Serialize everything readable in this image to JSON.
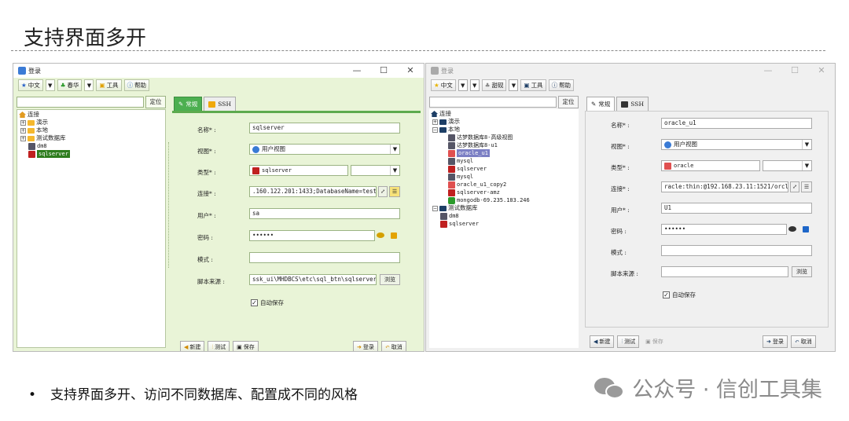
{
  "slide": {
    "title": "支持界面多开",
    "bullet": "支持界面多开、访问不同数据库、配置成不同的风格",
    "brand": "公众号 · 信创工具集"
  },
  "window1": {
    "title": "登录",
    "controls": [
      "—",
      "☐",
      "✕"
    ],
    "toolbar": {
      "lang": "中文",
      "theme": "春华",
      "tools": "工具",
      "help": "帮助"
    },
    "locate": "定位",
    "tree": {
      "root": "连接",
      "folders": [
        "演示",
        "本地",
        "测试数据库"
      ],
      "items": [
        "dm8",
        "sqlserver"
      ]
    },
    "tabs": [
      "常规",
      "SSH"
    ],
    "form": {
      "name_label": "名称* :",
      "name_value": "sqlserver",
      "view_label": "视图* :",
      "view_value": "用户视图",
      "type_label": "类型* :",
      "type_value": "sqlserver",
      "conn_label": "连接* :",
      "conn_value": ".160.122.201:1433;DatabaseName=test",
      "user_label": "用户* :",
      "user_value": "sa",
      "pwd_label": "密码 :",
      "pwd_value": "••••••",
      "schema_label": "模式 :",
      "schema_value": "",
      "script_label": "脚本来源 :",
      "script_value": "ssk_ui\\MHDBCS\\etc\\sql_btn\\sqlserver",
      "browse": "浏览",
      "autosave": "自动保存"
    },
    "buttons": {
      "new": "新建",
      "test": "测试",
      "save": "保存",
      "login": "登录",
      "cancel": "取消"
    }
  },
  "window2": {
    "title": "登录",
    "controls": [
      "—",
      "☐",
      "✕"
    ],
    "toolbar": {
      "lang": "中文",
      "theme": "甜砚",
      "tools": "工具",
      "help": "帮助"
    },
    "locate": "定位",
    "tree": {
      "root": "连接",
      "folders": [
        "演示",
        "本地"
      ],
      "items": [
        "达梦数据库8-高级视图",
        "达梦数据库8-u1",
        "oracle_u1",
        "mysql",
        "sqlserver",
        "mysql",
        "oracle_u1_copy2",
        "sqlserver-amz",
        "mongodb-69.235.183.246"
      ],
      "folder2": "测试数据库",
      "items2": [
        "dm8",
        "sqlserver"
      ]
    },
    "tabs": [
      "常规",
      "SSH"
    ],
    "form": {
      "name_label": "名称* :",
      "name_value": "oracle_u1",
      "view_label": "视图* :",
      "view_value": "用户视图",
      "type_label": "类型* :",
      "type_value": "oracle",
      "conn_label": "连接* :",
      "conn_value": "racle:thin:@192.168.23.11:1521/orcl",
      "user_label": "用户* :",
      "user_value": "U1",
      "pwd_label": "密码 :",
      "pwd_value": "••••••",
      "schema_label": "模式 :",
      "schema_value": "",
      "script_label": "脚本来源 :",
      "script_value": "",
      "browse": "浏览",
      "autosave": "自动保存"
    },
    "buttons": {
      "new": "新建",
      "test": "测试",
      "save": "保存",
      "login": "登录",
      "cancel": "取消"
    }
  }
}
